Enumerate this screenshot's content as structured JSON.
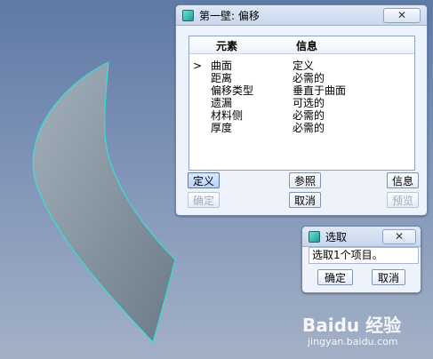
{
  "main_dialog": {
    "title": "第一壁: 偏移",
    "close_glyph": "✕",
    "columns": [
      "元素",
      "信息"
    ],
    "rows": [
      {
        "marker": ">",
        "element": "曲面",
        "info": "定义"
      },
      {
        "marker": "",
        "element": "距离",
        "info": "必需的"
      },
      {
        "marker": "",
        "element": "偏移类型",
        "info": "垂直于曲面"
      },
      {
        "marker": "",
        "element": "遗漏",
        "info": "可选的"
      },
      {
        "marker": "",
        "element": "材料侧",
        "info": "必需的"
      },
      {
        "marker": "",
        "element": "厚度",
        "info": "必需的"
      }
    ],
    "buttons": {
      "define": "定义",
      "refer": "参照",
      "info": "信息",
      "confirm": "确定",
      "cancel": "取消",
      "preview": "预览"
    }
  },
  "select_dialog": {
    "title": "选取",
    "close_glyph": "✕",
    "prompt": "选取1个项目。",
    "buttons": {
      "confirm": "确定",
      "cancel": "取消"
    }
  },
  "watermark": {
    "brand": "Baidu 经验",
    "url": "jingyan.baidu.com"
  },
  "colors": {
    "surface_edge": "#34e0d8",
    "surface_fill": "#8a9aa6",
    "background_top": "#5f7aa6",
    "background_bottom": "#a3b1c7"
  }
}
